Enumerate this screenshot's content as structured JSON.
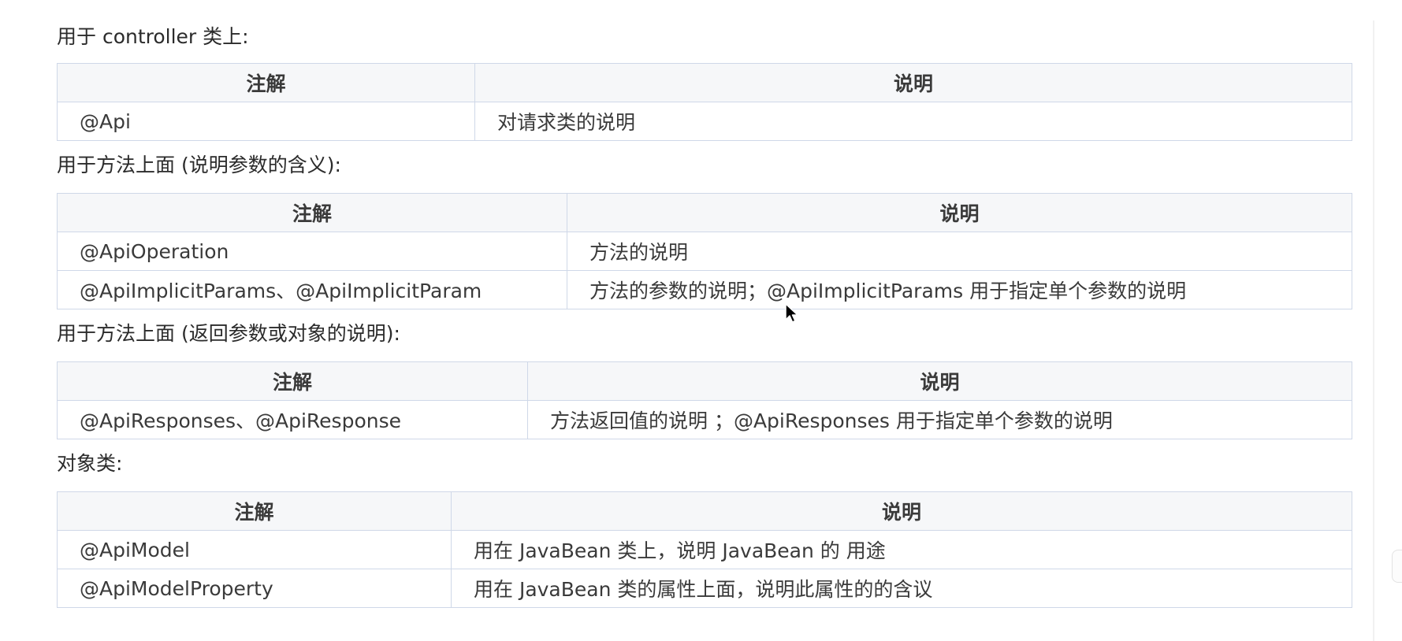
{
  "sections": [
    {
      "title": "用于 controller 类上:",
      "columns": [
        "注解",
        "说明"
      ],
      "rows": [
        [
          "@Api",
          "对请求类的说明"
        ]
      ]
    },
    {
      "title": "用于方法上面 (说明参数的含义):",
      "columns": [
        "注解",
        "说明"
      ],
      "rows": [
        [
          "@ApiOperation",
          "方法的说明"
        ],
        [
          "@ApiImplicitParams、@ApiImplicitParam",
          "方法的参数的说明；@ApiImplicitParams 用于指定单个参数的说明"
        ]
      ]
    },
    {
      "title": "用于方法上面 (返回参数或对象的说明):",
      "columns": [
        "注解",
        "说明"
      ],
      "rows": [
        [
          "@ApiResponses、@ApiResponse",
          "方法返回值的说明 ；@ApiResponses 用于指定单个参数的说明"
        ]
      ]
    },
    {
      "title": "对象类:",
      "columns": [
        "注解",
        "说明"
      ],
      "rows": [
        [
          "@ApiModel",
          "用在 JavaBean 类上，说明 JavaBean 的 用途"
        ],
        [
          "@ApiModelProperty",
          "用在 JavaBean 类的属性上面，说明此属性的的含议"
        ]
      ]
    }
  ]
}
